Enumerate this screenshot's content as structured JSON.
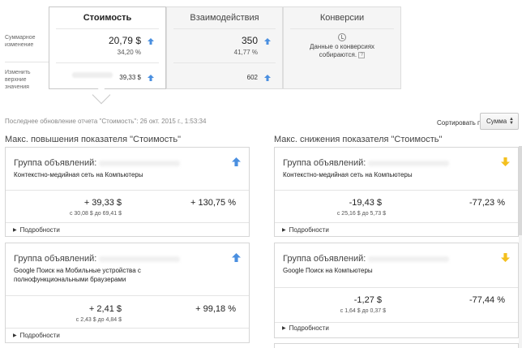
{
  "summary": {
    "row_labels": [
      "Суммарное изменение",
      "Изменить верхние значения"
    ],
    "metrics": [
      {
        "title": "Стоимость",
        "value": "20,79 $",
        "percent": "34,20 %",
        "top_value": "39,33 $",
        "selected": true
      },
      {
        "title": "Взаимодействия",
        "value": "350",
        "percent": "41,77 %",
        "top_value": "602",
        "selected": false
      },
      {
        "title": "Конверсии",
        "message": "Данные о конверсиях собираются.",
        "help": "?",
        "selected": false
      }
    ]
  },
  "last_update": "Последнее обновление отчета \"Стоимость\": 26 окт. 2015 г., 1:53:34",
  "sort": {
    "label": "Сортировать по:",
    "value": "Сумма"
  },
  "increase": {
    "title": "Макс. повышения показателя \"Стоимость\"",
    "cards": [
      {
        "group": "Группа объявлений:",
        "target": "Контекстно-медийная сеть на Компьютеры",
        "amount": "+ 39,33 $",
        "range": "с 30,08 $ до 69,41 $",
        "percent": "+ 130,75 %",
        "details": "Подробности"
      },
      {
        "group": "Группа объявлений:",
        "target": "Google Поиск на Мобильные устройства с полнофункциональными браузерами",
        "amount": "+ 2,41 $",
        "range": "с 2,43 $ до 4,84 $",
        "percent": "+ 99,18 %",
        "details": "Подробности"
      }
    ]
  },
  "decrease": {
    "title": "Макс. снижения показателя \"Стоимость\"",
    "cards": [
      {
        "group": "Группа объявлений:",
        "target": "Контекстно-медийная сеть на Компьютеры",
        "amount": "-19,43 $",
        "range": "с 25,16 $ до 5,73 $",
        "percent": "-77,23 %",
        "details": "Подробности"
      },
      {
        "group": "Группа объявлений:",
        "target": "Google Поиск на Компьютеры",
        "amount": "-1,27 $",
        "range": "с 1,64 $ до 0,37 $",
        "percent": "-77,44 %",
        "details": "Подробности"
      }
    ]
  },
  "colors": {
    "up_arrow": "#4a8fe0",
    "down_arrow": "#f4c01e",
    "selected_bg": "#ffffff",
    "tab_bg": "#f5f5f5"
  }
}
